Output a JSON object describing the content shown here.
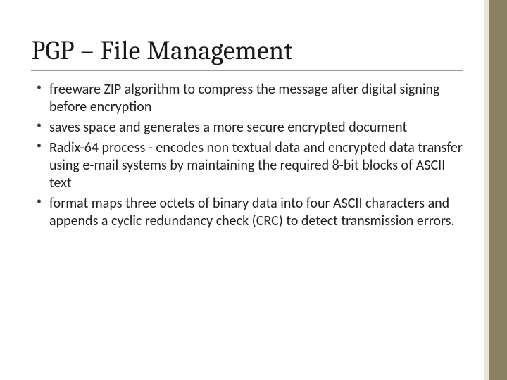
{
  "slide": {
    "title": "PGP – File Management",
    "bullets": [
      "freeware ZIP algorithm to compress the message after digital signing before encryption",
      "saves space and generates a more secure encrypted document",
      "Radix-64 process  - encodes non textual data and encrypted data transfer using e-mail systems by maintaining the required 8-bit blocks of ASCII text",
      "format maps three octets of binary data into four ASCII characters and appends a cyclic redundancy check (CRC) to detect transmission errors."
    ]
  },
  "theme": {
    "accent_band": "#8a8160",
    "accent_band_light": "#e9e6db"
  }
}
